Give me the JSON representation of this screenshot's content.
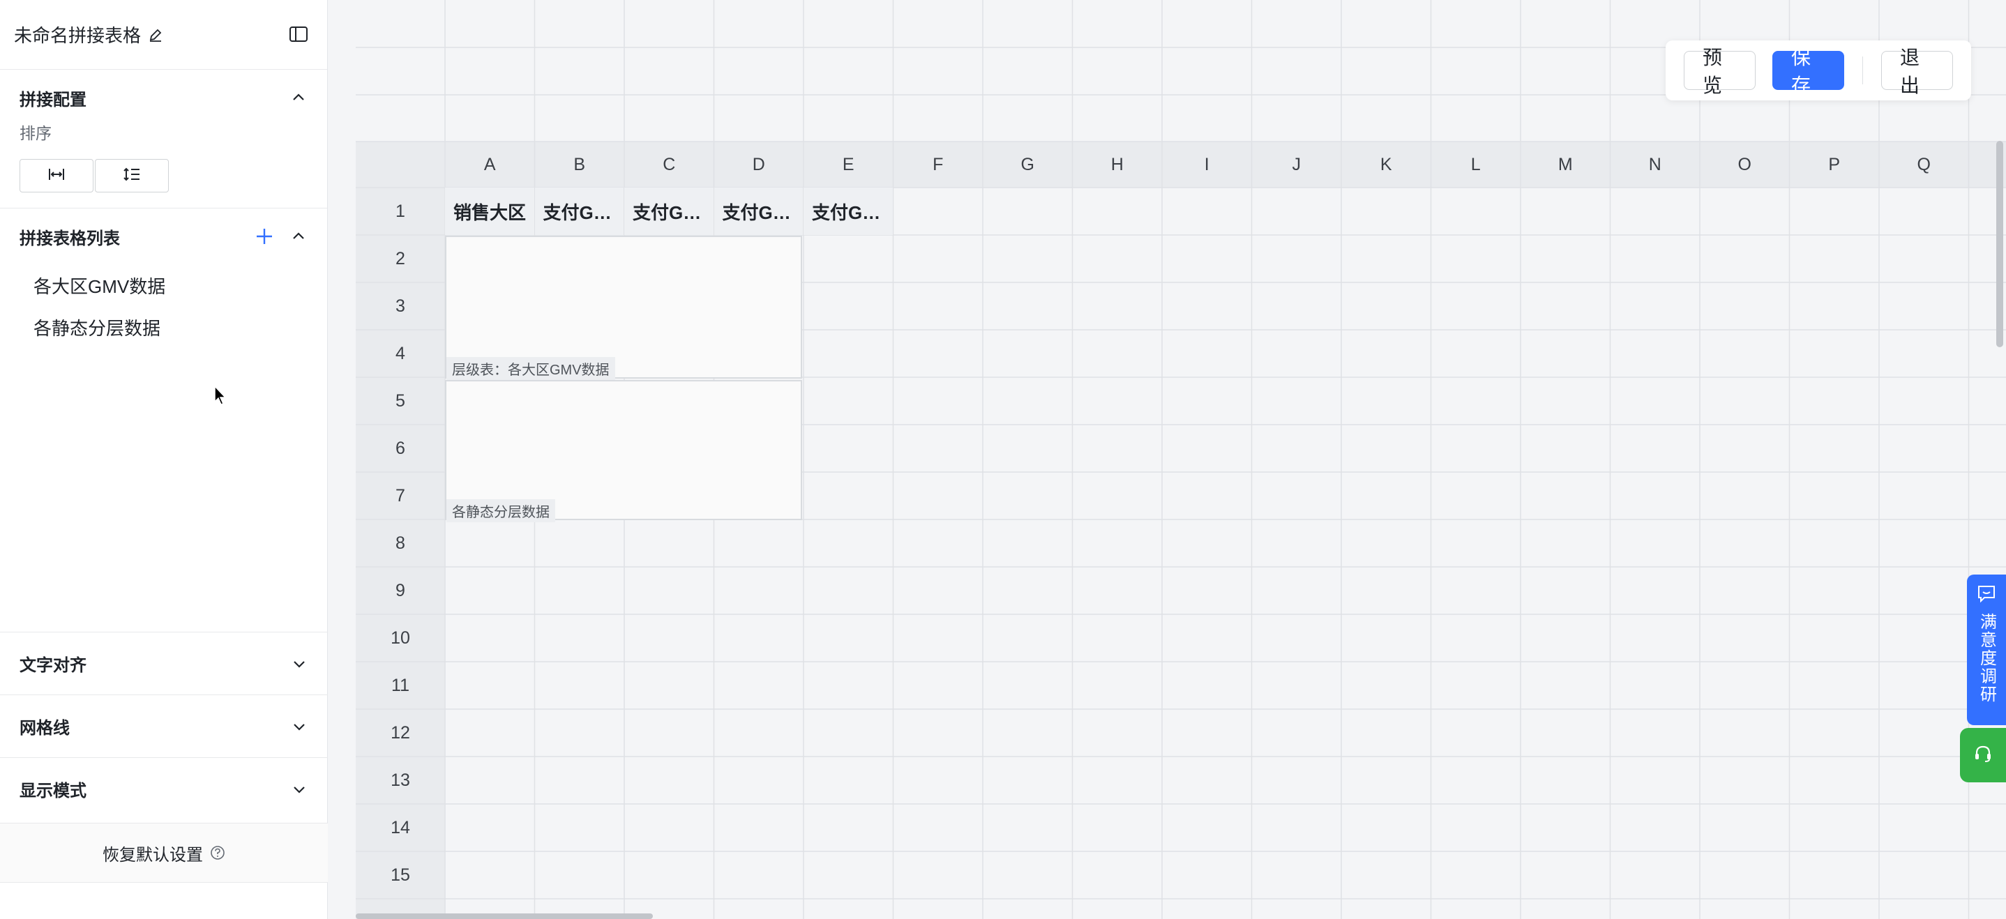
{
  "sidebar": {
    "title": "未命名拼接表格",
    "config_section": {
      "title": "拼接配置",
      "sort_label": "排序"
    },
    "table_list_section": {
      "title": "拼接表格列表",
      "items": [
        {
          "label": "各大区GMV数据"
        },
        {
          "label": "各静态分层数据"
        }
      ]
    },
    "text_align": "文字对齐",
    "gridlines": "网格线",
    "display_mode": "显示模式",
    "restore": "恢复默认设置"
  },
  "toolbar": {
    "preview": "预览",
    "save": "保存",
    "exit": "退出"
  },
  "sheet": {
    "columns": [
      "A",
      "B",
      "C",
      "D",
      "E",
      "F",
      "G",
      "H",
      "I",
      "J",
      "K",
      "L",
      "M",
      "N",
      "O",
      "P",
      "Q"
    ],
    "rows": [
      "1",
      "2",
      "3",
      "4",
      "5",
      "6",
      "7",
      "8",
      "9",
      "10",
      "11",
      "12",
      "13",
      "14",
      "15"
    ],
    "header_cells": [
      "销售大区",
      "支付G…",
      "支付G…",
      "支付G…",
      "支付G…"
    ],
    "block1_label": "层级表：各大区GMV数据",
    "block2_label": "各静态分层数据"
  },
  "float": {
    "survey": "满意度调研"
  },
  "colors": {
    "primary": "#3370ff",
    "support": "#34b348"
  }
}
